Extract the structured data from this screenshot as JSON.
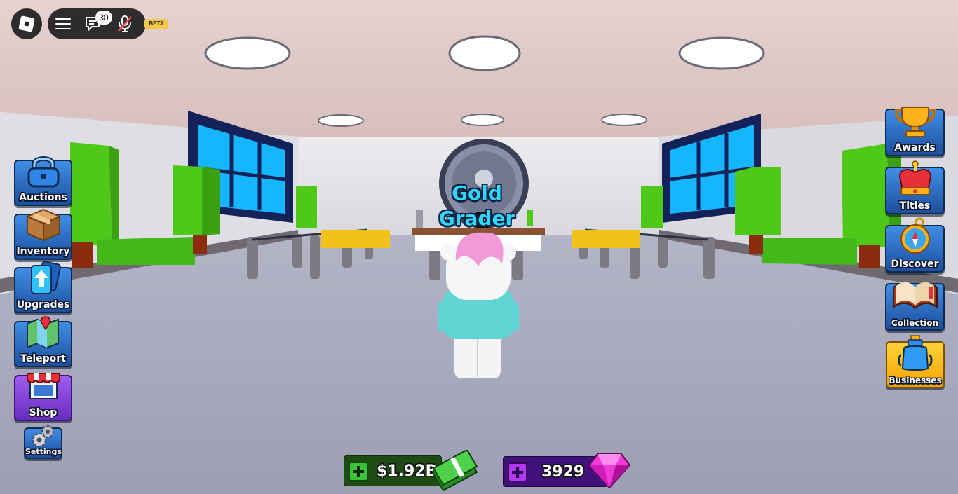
{
  "system_bar": {
    "roblox_menu_icon": "roblox-logo-icon",
    "menu_icon": "hamburger-icon",
    "chat_icon": "chat-icon",
    "chat_unread_count": "30",
    "mic_icon": "mic-muted-icon",
    "beta_label": "BETA"
  },
  "world": {
    "npc_name": "Gold Grader"
  },
  "left_menu": [
    {
      "label": "Auctions",
      "icon": "padlock-icon"
    },
    {
      "label": "Inventory",
      "icon": "box-icon"
    },
    {
      "label": "Upgrades",
      "icon": "upgrade-cards-icon"
    },
    {
      "label": "Teleport",
      "icon": "map-icon"
    },
    {
      "label": "Shop",
      "icon": "shop-stall-icon"
    },
    {
      "label": "Settings",
      "icon": "gears-icon"
    }
  ],
  "right_menu": [
    {
      "label": "Awards",
      "icon": "trophy-icon"
    },
    {
      "label": "Titles",
      "icon": "crown-icon"
    },
    {
      "label": "Discover",
      "icon": "compass-icon"
    },
    {
      "label": "Collection",
      "icon": "book-icon"
    },
    {
      "label": "Businesses",
      "icon": "bottle-icon"
    }
  ],
  "currency": {
    "cash": "$1.92B",
    "gems": "3929",
    "cash_icon": "cash-stack-icon",
    "gem_icon": "pink-gem-icon",
    "add_icon": "plus-icon"
  },
  "colors": {
    "hud_blue": "#2f6fc8",
    "shop_purple": "#7b3ad6",
    "businesses_gold": "#f4b400",
    "cash_green": "#1e4a14",
    "gems_purple": "#40127a",
    "npc_label": "#2fd6ff"
  }
}
